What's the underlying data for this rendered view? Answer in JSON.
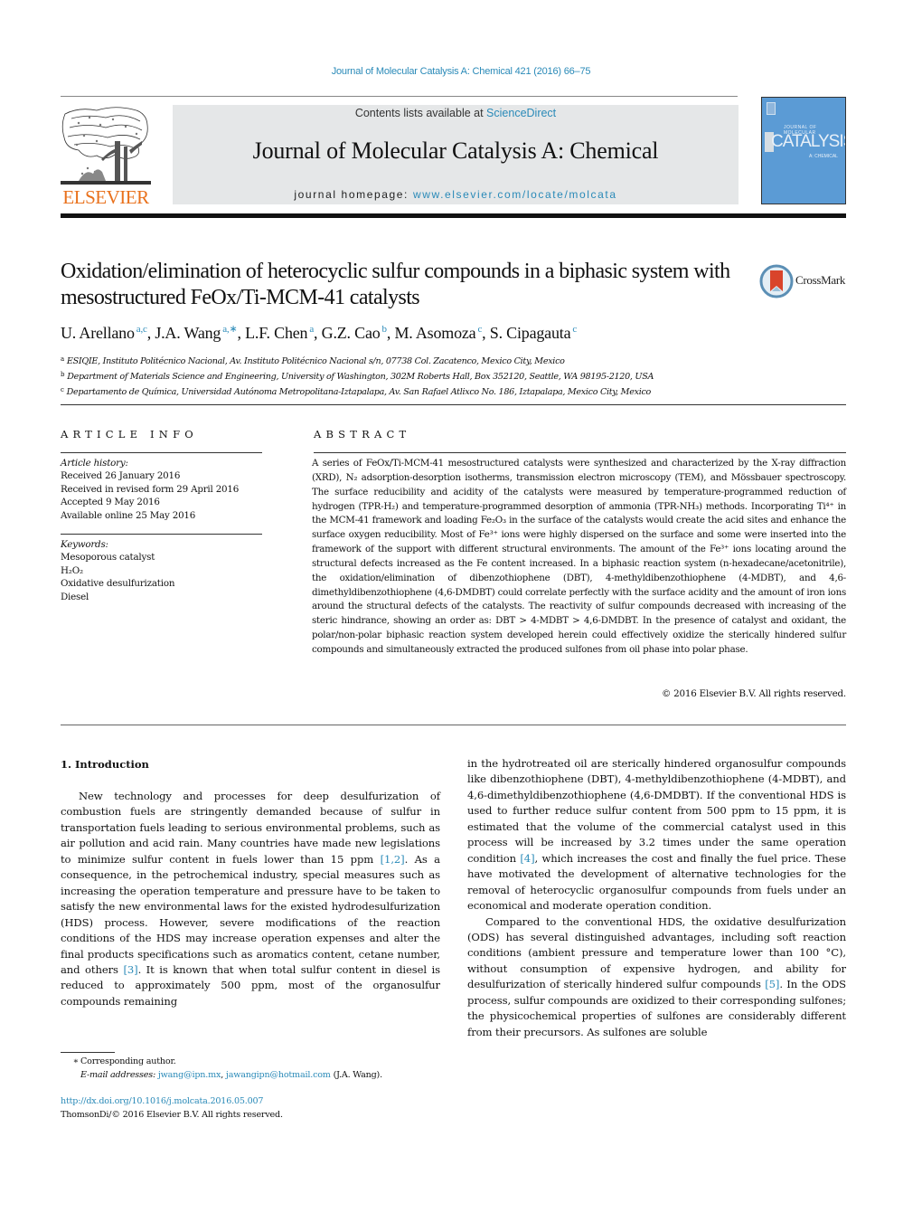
{
  "running_header": "Journal of Molecular Catalysis A: Chemical 421 (2016) 66–75",
  "masthead": {
    "publisher_logo_text": "ELSEVIER",
    "contents_prefix": "Contents lists available at ",
    "contents_link": "ScienceDirect",
    "journal_title": "Journal of Molecular Catalysis A: Chemical",
    "homepage_prefix": "journal homepage: ",
    "homepage_link": "www.elsevier.com/locate/molcata",
    "cover": {
      "top_text": "JOURNAL OF MOLECULAR",
      "main_text": "CATALYSIS",
      "sub_text": "A: CHEMICAL",
      "color": "#5b9bd5"
    }
  },
  "article": {
    "title": "Oxidation/elimination of heterocyclic sulfur compounds in a biphasic system with mesostructured FeOx/Ti-MCM-41 catalysts",
    "crossmark_label": "CrossMark",
    "authors": [
      {
        "name": "U. Arellano",
        "sup": "a,c",
        "sep": ", "
      },
      {
        "name": "J.A. Wang",
        "sup": "a,∗",
        "sep": ", "
      },
      {
        "name": "L.F. Chen",
        "sup": "a",
        "sep": ", "
      },
      {
        "name": "G.Z. Cao",
        "sup": "b",
        "sep": ", "
      },
      {
        "name": "M. Asomoza",
        "sup": "c",
        "sep": ", "
      },
      {
        "name": "S. Cipagauta",
        "sup": "c",
        "sep": ""
      }
    ],
    "affiliations": [
      {
        "key": "a",
        "text": "ESIQIE, Instituto Politécnico Nacional, Av. Instituto Politécnico Nacional s/n, 07738 Col. Zacatenco, Mexico City, Mexico"
      },
      {
        "key": "b",
        "text": "Department of Materials Science and Engineering, University of Washington, 302M Roberts Hall, Box 352120, Seattle, WA 98195-2120, USA"
      },
      {
        "key": "c",
        "text": "Departamento de Química, Universidad Autónoma Metropolitana-Iztapalapa, Av. San Rafael Atlixco No. 186, Iztapalapa, Mexico City, Mexico"
      }
    ]
  },
  "article_info": {
    "heading": "ARTICLE INFO",
    "history_label": "Article history:",
    "history": [
      "Received 26 January 2016",
      "Received in revised form 29 April 2016",
      "Accepted 9 May 2016",
      "Available online 25 May 2016"
    ],
    "keywords_label": "Keywords:",
    "keywords": [
      "Mesoporous catalyst",
      "H₂O₂",
      "Oxidative desulfurization",
      "Diesel"
    ]
  },
  "abstract": {
    "heading": "ABSTRACT",
    "text": "A series of FeOx/Ti-MCM-41 mesostructured catalysts were synthesized and characterized by the X-ray diffraction (XRD), N₂ adsorption-desorption isotherms, transmission electron microscopy (TEM), and Mössbauer spectroscopy. The surface reducibility and acidity of the catalysts were measured by temperature-programmed reduction of hydrogen (TPR-H₂) and temperature-programmed desorption of ammonia (TPR-NH₃) methods. Incorporating Ti⁴⁺ in the MCM-41 framework and loading Fe₂O₃ in the surface of the catalysts would create the acid sites and enhance the surface oxygen reducibility. Most of Fe³⁺ ions were highly dispersed on the surface and some were inserted into the framework of the support with different structural environments. The amount of the Fe³⁺ ions locating around the structural defects increased as the Fe content increased. In a biphasic reaction system (n-hexadecane/acetonitrile), the oxidation/elimination of dibenzothiophene (DBT), 4-methyldibenzothiophene (4-MDBT), and 4,6-dimethyldibenzothiophene (4,6-DMDBT) could correlate perfectly with the surface acidity and the amount of iron ions around the structural defects of the catalysts. The reactivity of sulfur compounds decreased with increasing of the steric hindrance, showing an order as: DBT > 4-MDBT > 4,6-DMDBT. In the presence of catalyst and oxidant, the polar/non-polar biphasic reaction system developed herein could effectively oxidize the sterically hindered sulfur compounds and simultaneously extracted the produced sulfones from oil phase into polar phase.",
    "copyright": "© 2016 Elsevier B.V. All rights reserved."
  },
  "body": {
    "section_heading": "1.  Introduction",
    "left_column": {
      "p1_a": "New technology and processes for deep desulfurization of combustion fuels are stringently demanded because of sulfur in transportation fuels leading to serious environmental problems, such as air pollution and acid rain. Many countries have made new legislations to minimize sulfur content in fuels lower than 15 ppm ",
      "ref1": "[1,2]",
      "p1_b": ". As a consequence, in the petrochemical industry, special measures such as increasing the operation temperature and pressure have to be taken to satisfy the new environmental laws for the existed hydrodesulfurization (HDS) process. However, severe modifications of the reaction conditions of the HDS may increase operation expenses and alter the final products specifications such as aromatics content, cetane number, and others ",
      "ref2": "[3]",
      "p1_c": ". It is known that when total sulfur content in diesel is reduced to approximately 500 ppm, most of the organosulfur compounds remaining"
    },
    "right_column": {
      "p1_a": "in the hydrotreated oil are sterically hindered organosulfur compounds like dibenzothiophene (DBT), 4-methyldibenzothiophene (4-MDBT), and 4,6-dimethyldibenzothiophene (4,6-DMDBT). If the conventional HDS is used to further reduce sulfur content from 500 ppm to 15 ppm, it is estimated that the volume of the commercial catalyst used in this process will be increased by 3.2 times under the same operation condition ",
      "ref1": "[4]",
      "p1_b": ", which increases the cost and finally the fuel price. These have motivated the development of alternative technologies for the removal of heterocyclic organosulfur compounds from fuels under an economical and moderate operation condition.",
      "p2_a": "Compared to the conventional HDS, the oxidative desulfurization (ODS) has several distinguished advantages, including soft reaction conditions (ambient pressure and temperature lower than 100 °C), without consumption of expensive hydrogen, and ability for desulfurization of sterically hindered sulfur compounds ",
      "ref2": "[5]",
      "p2_b": ". In the ODS process, sulfur compounds are oxidized to their corresponding sulfones; the physicochemical properties of sulfones are considerably different from their precursors. As sulfones are soluble"
    }
  },
  "footnotes": {
    "star": "∗",
    "corresponding": "Corresponding author.",
    "email_label": "E-mail addresses:",
    "email_1": "jwang@ipn.mx",
    "email_sep": ", ",
    "email_2": "jawangipn@hotmail.com",
    "email_owner": " (J.A. Wang).",
    "doi": "http://dx.doi.org/10.1016/j.molcata.2016.05.007",
    "rights": "ThomsonDi/© 2016 Elsevier B.V. All rights reserved."
  },
  "colors": {
    "link": "#2a8ab8",
    "elsevier_orange": "#e9711c",
    "masthead_bg": "#e5e7e8"
  }
}
